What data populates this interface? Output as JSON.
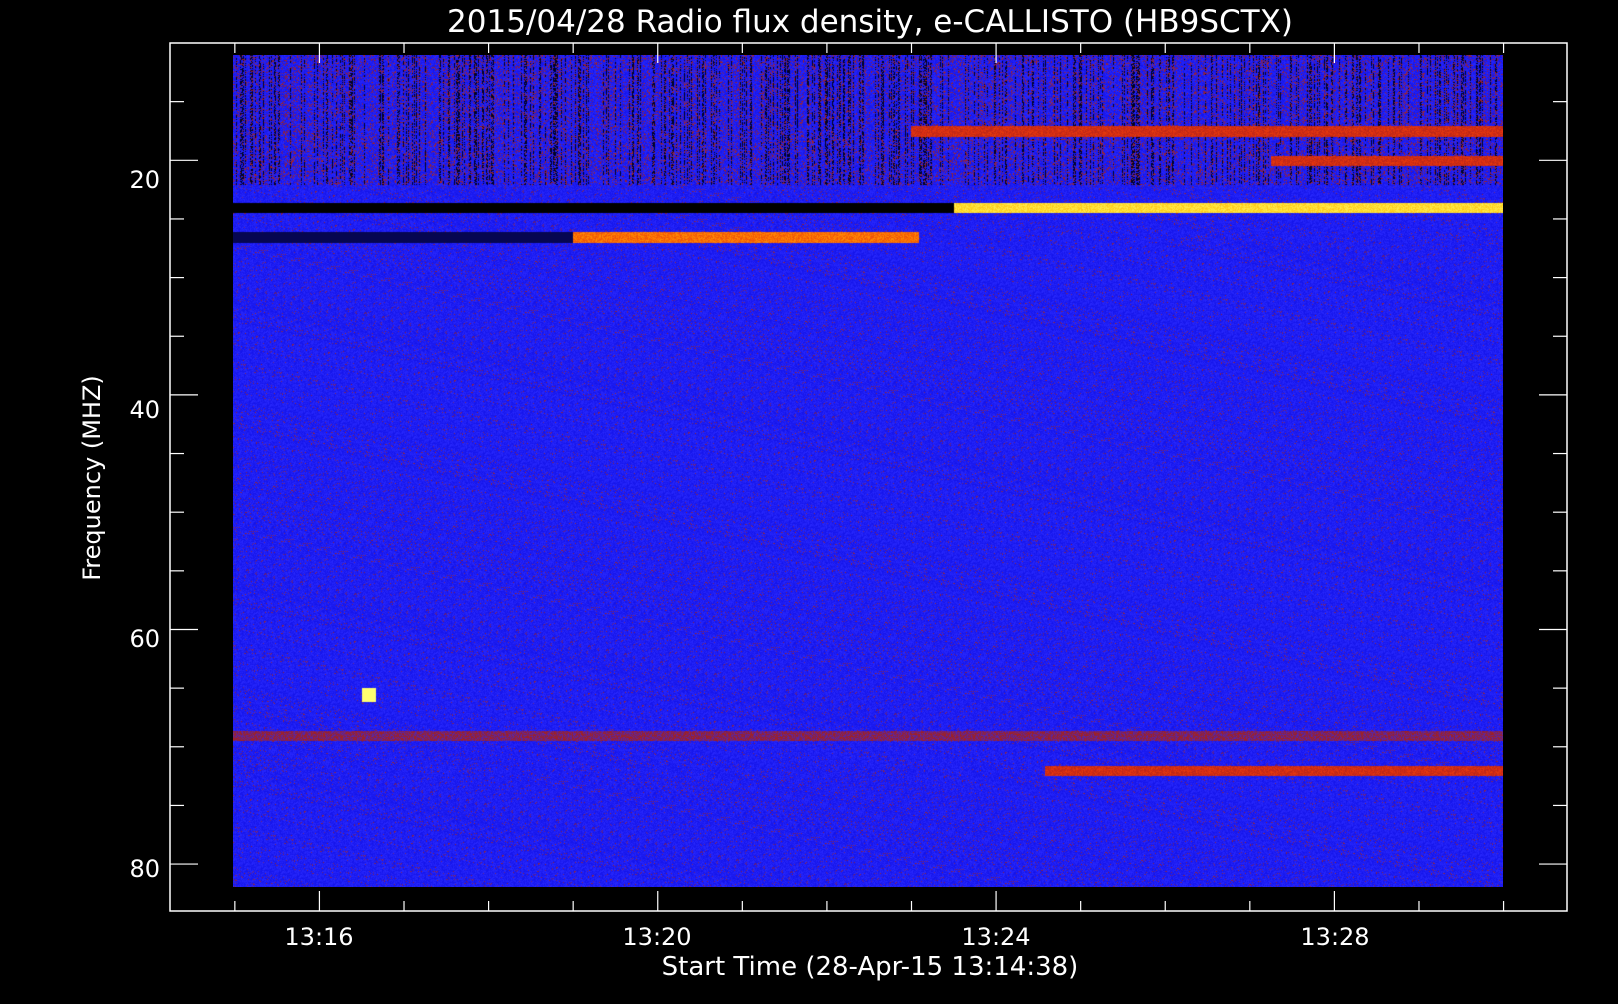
{
  "chart_data": {
    "type": "heatmap",
    "title": "2015/04/28  Radio flux density, e-CALLISTO (HB9SCTX)",
    "xlabel": "Start Time (28-Apr-15 13:14:38)",
    "ylabel": "Frequency (MHZ)",
    "x_ticks": [
      "13:16",
      "13:20",
      "13:24",
      "13:28"
    ],
    "y_ticks": [
      "20",
      "40",
      "60",
      "80"
    ],
    "x_range": [
      "13:14:14",
      "13:30:45"
    ],
    "y_range": [
      10,
      84
    ],
    "y_inverted": true,
    "data_time_range": [
      "13:14:59",
      "13:30:00"
    ],
    "data_freq_range": [
      11.0,
      82.0
    ],
    "grid": false,
    "legend": "none",
    "colormap": [
      "#000000",
      "#1010e6",
      "#2a2aff",
      "#a0201e",
      "#e03010",
      "#ff7a00",
      "#ffd21e",
      "#ffff70"
    ],
    "features": [
      {
        "kind": "band",
        "freq": 24.0,
        "t_start": "13:23:30",
        "t_end": "13:30:00",
        "intensity": 0.95
      },
      {
        "kind": "band",
        "freq": 26.5,
        "t_start": "13:19:00",
        "t_end": "13:23:05",
        "intensity": 0.75
      },
      {
        "kind": "band",
        "freq": 17.5,
        "t_start": "13:23:00",
        "t_end": "13:30:00",
        "intensity": 0.6
      },
      {
        "kind": "band",
        "freq": 20.0,
        "t_start": "13:27:15",
        "t_end": "13:30:00",
        "intensity": 0.6
      },
      {
        "kind": "band",
        "freq": 72.0,
        "t_start": "13:24:35",
        "t_end": "13:30:00",
        "intensity": 0.6
      },
      {
        "kind": "band",
        "freq": 69.0,
        "t_start": "13:14:59",
        "t_end": "13:30:00",
        "intensity": 0.45
      },
      {
        "kind": "band",
        "freq": 24.0,
        "t_start": "13:14:59",
        "t_end": "13:23:30",
        "intensity": 0.0
      },
      {
        "kind": "band",
        "freq": 26.5,
        "t_start": "13:14:59",
        "t_end": "13:19:00",
        "intensity": 0.05
      },
      {
        "kind": "spot",
        "freq": 65.5,
        "time": "13:16:35",
        "intensity": 1.0
      }
    ]
  }
}
